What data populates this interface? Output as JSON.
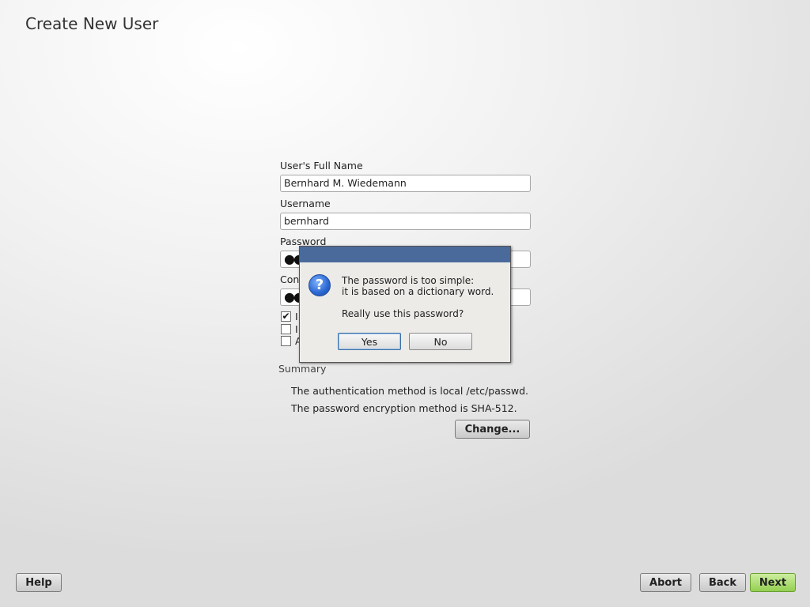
{
  "page": {
    "title": "Create New User"
  },
  "form": {
    "full_name_label": "User's Full Name",
    "full_name_value": "Bernhard M. Wiedemann",
    "username_label": "Username",
    "username_value": "bernhard",
    "password_label": "Password",
    "password_value": "●●",
    "confirm_label": "Con",
    "confirm_value": "●●",
    "checkboxes": [
      {
        "checked": true,
        "label_visible": "I"
      },
      {
        "checked": false,
        "label_visible": "I"
      },
      {
        "checked": false,
        "label_visible": "A"
      }
    ],
    "check_glyph": "✔"
  },
  "summary": {
    "title": "Summary",
    "line1": "The authentication method is local /etc/passwd.",
    "line2": "The password encryption method is SHA-512.",
    "change_button": "Change..."
  },
  "dialog": {
    "icon": "question-icon",
    "icon_glyph": "?",
    "message_line1": "The password is too simple:",
    "message_line2": "it is based on a dictionary word.",
    "question": "Really use this password?",
    "yes_label": "Yes",
    "no_label": "No"
  },
  "footer": {
    "help_label": "Help",
    "abort_label": "Abort",
    "back_label": "Back",
    "next_label": "Next"
  },
  "colors": {
    "titlebar": "#4a6a9b",
    "next_button": "#93cf50"
  }
}
